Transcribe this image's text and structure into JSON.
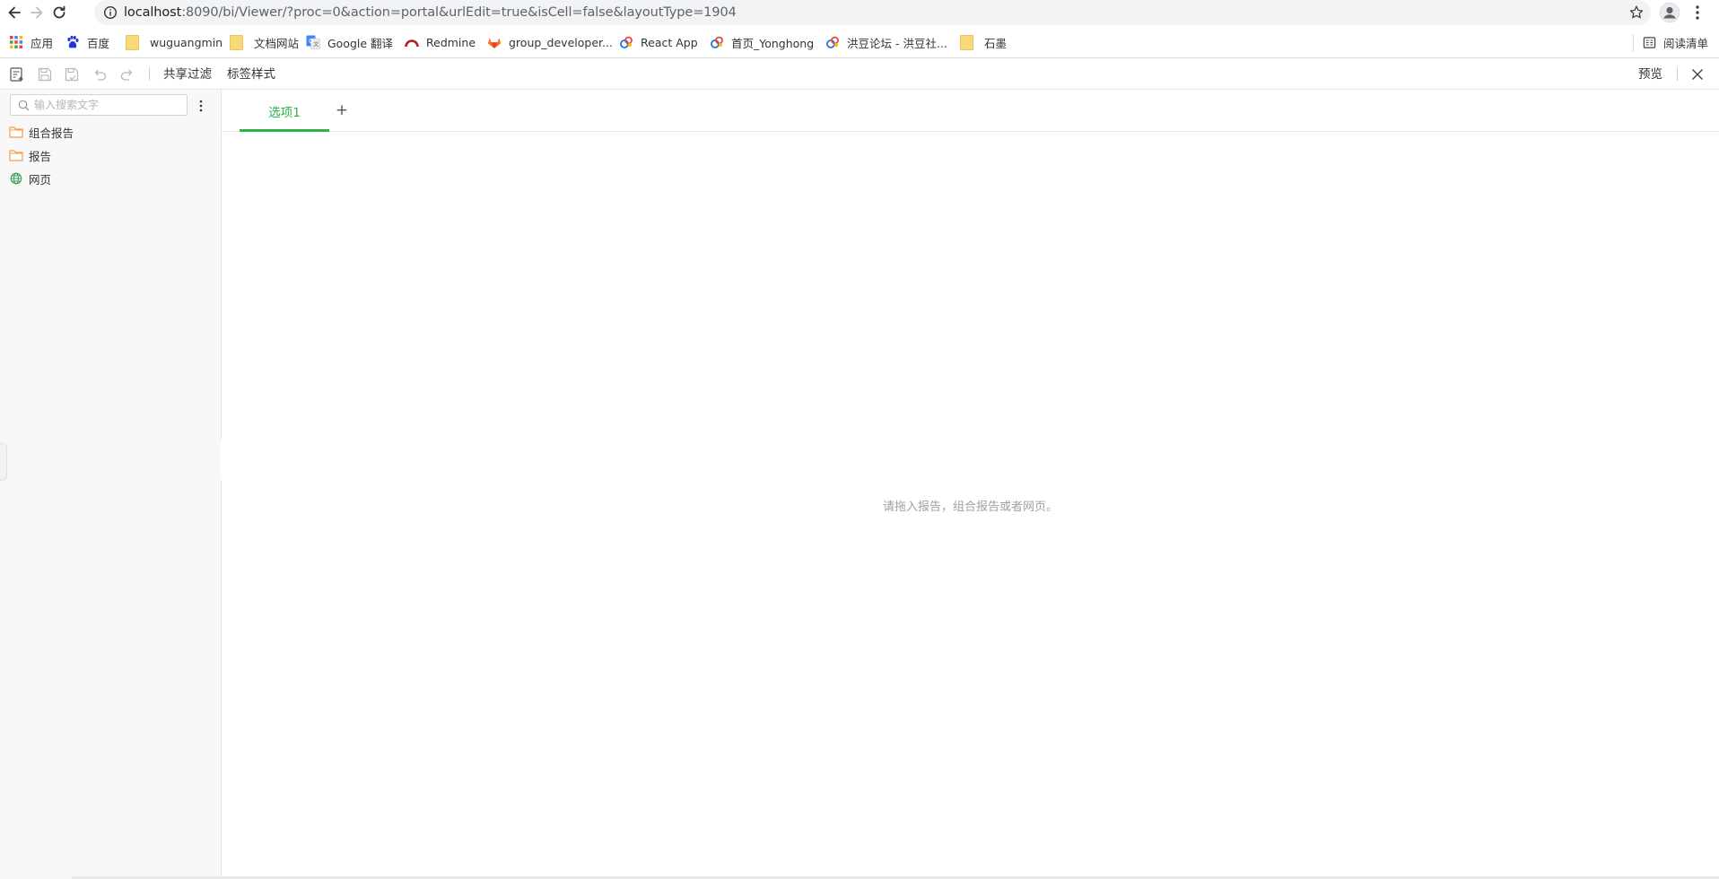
{
  "browser": {
    "url_host": "localhost",
    "url_rest": ":8090/bi/Viewer/?proc=0&action=portal&urlEdit=true&isCell=false&layoutType=1904"
  },
  "bookmarks": {
    "items": [
      {
        "label": "应用"
      },
      {
        "label": "百度"
      },
      {
        "label": "wuguangmin"
      },
      {
        "label": "文档网站"
      },
      {
        "label": "Google 翻译"
      },
      {
        "label": "Redmine"
      },
      {
        "label": "group_developer..."
      },
      {
        "label": "React App"
      },
      {
        "label": "首页_Yonghong"
      },
      {
        "label": "洪豆论坛 - 洪豆社..."
      },
      {
        "label": "石墨"
      }
    ],
    "reading_list": "阅读清单"
  },
  "toolbar": {
    "share_filter": "共享过滤",
    "tab_style": "标签样式",
    "preview": "预览"
  },
  "sidebar": {
    "search_placeholder": "输入搜索文字",
    "items": [
      {
        "label": "组合报告",
        "icon": "folder-icon"
      },
      {
        "label": "报告",
        "icon": "folder-icon"
      },
      {
        "label": "网页",
        "icon": "globe-icon"
      }
    ]
  },
  "main": {
    "tabs": [
      {
        "label": "选项1"
      }
    ],
    "add_tab": "+",
    "empty_hint": "请拖入报告，组合报告或者网页。"
  },
  "colors": {
    "accent": "#2bb24c",
    "folder": "#f0a050",
    "globe": "#3a9e5a"
  }
}
